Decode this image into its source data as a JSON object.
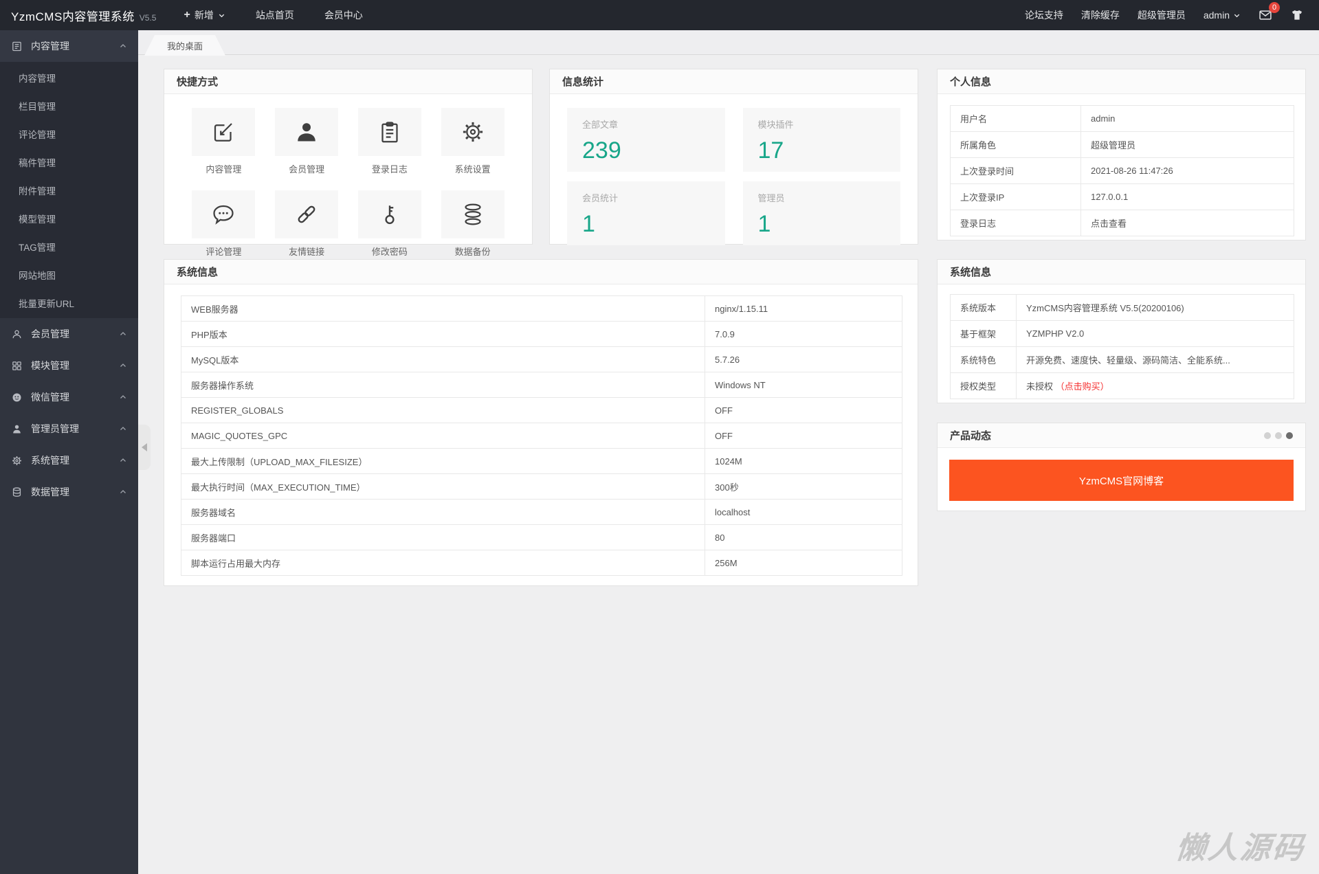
{
  "topbar": {
    "brand": "YzmCMS内容管理系统",
    "version": "V5.5",
    "nav": {
      "add": "新增",
      "site_home": "站点首页",
      "member_center": "会员中心"
    },
    "right": {
      "forum_support": "论坛支持",
      "clear_cache": "清除缓存",
      "role": "超级管理员",
      "username": "admin",
      "badge": "0"
    }
  },
  "sidebar": {
    "groups": [
      {
        "label": "内容管理",
        "icon": "content-icon",
        "items": [
          "内容管理",
          "栏目管理",
          "评论管理",
          "稿件管理",
          "附件管理",
          "模型管理",
          "TAG管理",
          "网站地图",
          "批量更新URL"
        ]
      },
      {
        "label": "会员管理",
        "icon": "member-icon"
      },
      {
        "label": "模块管理",
        "icon": "module-icon"
      },
      {
        "label": "微信管理",
        "icon": "wechat-icon"
      },
      {
        "label": "管理员管理",
        "icon": "admin-icon"
      },
      {
        "label": "系统管理",
        "icon": "system-icon"
      },
      {
        "label": "数据管理",
        "icon": "data-icon"
      }
    ]
  },
  "tabs": {
    "desktop": "我的桌面"
  },
  "shortcuts": {
    "title": "快捷方式",
    "items": [
      {
        "label": "内容管理",
        "icon": "compose-icon"
      },
      {
        "label": "会员管理",
        "icon": "person-icon"
      },
      {
        "label": "登录日志",
        "icon": "clipboard-icon"
      },
      {
        "label": "系统设置",
        "icon": "gear-icon"
      },
      {
        "label": "评论管理",
        "icon": "comment-icon"
      },
      {
        "label": "友情链接",
        "icon": "link-icon"
      },
      {
        "label": "修改密码",
        "icon": "key-icon"
      },
      {
        "label": "数据备份",
        "icon": "database-icon"
      }
    ]
  },
  "stats": {
    "title": "信息统计",
    "items": [
      {
        "label": "全部文章",
        "value": "239"
      },
      {
        "label": "模块插件",
        "value": "17"
      },
      {
        "label": "会员统计",
        "value": "1"
      },
      {
        "label": "管理员",
        "value": "1"
      }
    ]
  },
  "profile": {
    "title": "个人信息",
    "rows": [
      {
        "label": "用户名",
        "value": "admin"
      },
      {
        "label": "所属角色",
        "value": "超级管理员"
      },
      {
        "label": "上次登录时间",
        "value": "2021-08-26 11:47:26"
      },
      {
        "label": "上次登录IP",
        "value": "127.0.0.1"
      },
      {
        "label": "登录日志",
        "value": "点击查看"
      }
    ]
  },
  "sysinfo": {
    "title": "系统信息",
    "rows": [
      {
        "label": "WEB服务器",
        "value": "nginx/1.15.11"
      },
      {
        "label": "PHP版本",
        "value": "7.0.9"
      },
      {
        "label": "MySQL版本",
        "value": "5.7.26"
      },
      {
        "label": "服务器操作系统",
        "value": "Windows NT"
      },
      {
        "label": "REGISTER_GLOBALS",
        "value": "OFF"
      },
      {
        "label": "MAGIC_QUOTES_GPC",
        "value": "OFF"
      },
      {
        "label": "最大上传限制（UPLOAD_MAX_FILESIZE）",
        "value": "1024M"
      },
      {
        "label": "最大执行时间（MAX_EXECUTION_TIME）",
        "value": "300秒"
      },
      {
        "label": "服务器域名",
        "value": "localhost"
      },
      {
        "label": "服务器端口",
        "value": "80"
      },
      {
        "label": "脚本运行占用最大内存",
        "value": "256M"
      }
    ]
  },
  "sysinfo2": {
    "title": "系统信息",
    "rows": [
      {
        "label": "系统版本",
        "value": "YzmCMS内容管理系统 V5.5(20200106)"
      },
      {
        "label": "基于框架",
        "value": "YZMPHP V2.0"
      },
      {
        "label": "系统特色",
        "value": "开源免费、速度快、轻量级、源码简洁、全能系统..."
      }
    ],
    "license": {
      "label": "授权类型",
      "value": "未授权 ",
      "link": "（点击购买）"
    }
  },
  "product": {
    "title": "产品动态",
    "banner": "YzmCMS官网博客"
  },
  "watermark": "懒人源码",
  "colors": {
    "accent_teal": "#18a689",
    "banner_orange": "#fc5420",
    "link_red": "#f52e2e",
    "badge_red": "#e6453c",
    "topbar_bg": "#24272e",
    "sidebar_bg": "#30343e"
  }
}
